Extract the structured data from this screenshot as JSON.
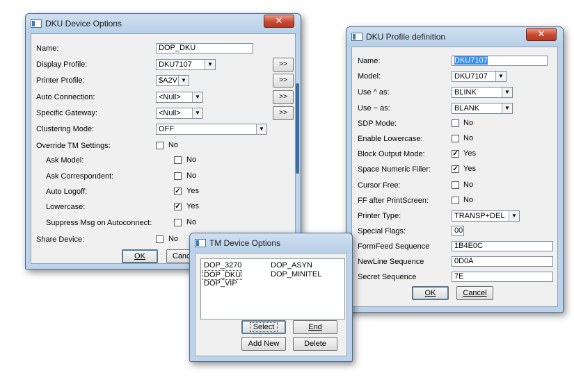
{
  "dku_window": {
    "title": "DKU Device Options",
    "name_label": "Name:",
    "name_value": "DOP_DKU",
    "display_profile_label": "Display Profile:",
    "display_profile_value": "DKU7107",
    "printer_profile_label": "Printer Profile:",
    "printer_profile_value": "$A2V",
    "auto_connection_label": "Auto Connection:",
    "auto_connection_value": "<Null>",
    "specific_gateway_label": "Specific Gateway:",
    "specific_gateway_value": "<Null>",
    "clustering_mode_label": "Clustering Mode:",
    "clustering_mode_value": "OFF",
    "override_label": "Override TM Settings:",
    "override_value": "No",
    "ask_model_label": "Ask Model:",
    "ask_model_value": "No",
    "ask_correspondent_label": "Ask Correspondent:",
    "ask_correspondent_value": "No",
    "auto_logoff_label": "Auto Logoff:",
    "auto_logoff_value": "Yes",
    "lowercase_label": "Lowercase:",
    "lowercase_value": "Yes",
    "suppress_label": "Suppress Msg on Autoconnect:",
    "suppress_value": "No",
    "share_label": "Share Device:",
    "share_value": "No",
    "more_button": ">>",
    "ok_button": "OK",
    "cancel_button": "Cancel"
  },
  "tm_window": {
    "title": "TM Device Options",
    "devices_col1": [
      "DOP_3270",
      "DOP_DKU",
      "DOP_VIP"
    ],
    "devices_col2": [
      "DOP_ASYN",
      "DOP_MINITEL"
    ],
    "select_button": "Select",
    "end_button": "End",
    "add_button": "Add New",
    "delete_button": "Delete"
  },
  "profile_window": {
    "title": "DKU Profile definition",
    "name_label": "Name:",
    "name_value": "DKU7107",
    "model_label": "Model:",
    "model_value": "DKU7107",
    "use_caret_label": "Use ^ as:",
    "use_caret_value": "BLINK",
    "use_tilde_label": "Use ~ as:",
    "use_tilde_value": "BLANK",
    "sdp_label": "SDP Mode:",
    "sdp_value": "No",
    "enable_lower_label": "Enable Lowercase:",
    "enable_lower_value": "No",
    "block_output_label": "Block Output Mode:",
    "block_output_value": "Yes",
    "space_numeric_label": "Space Numeric Filler:",
    "space_numeric_value": "Yes",
    "cursor_free_label": "Cursor Free:",
    "cursor_free_value": "No",
    "ff_after_label": "FF after PrintScreen:",
    "ff_after_value": "No",
    "printer_type_label": "Printer Type:",
    "printer_type_value": "TRANSP+DEL",
    "special_flags_label": "Special Flags:",
    "special_flags_value": "00",
    "formfeed_label": "FormFeed Sequence",
    "formfeed_value": "1B4E0C",
    "newline_label": "NewLine  Sequence",
    "newline_value": "0D0A",
    "secret_label": "Secret   Sequence",
    "secret_value": "7E",
    "ok_button": "OK",
    "cancel_button": "Cancel"
  },
  "icons": {
    "close": "close-icon",
    "dropdown": "chevron-down-icon",
    "check": "checkmark-icon",
    "window": "window-app-icon"
  },
  "colors": {
    "window_frame": "#bcd3e9",
    "close_button": "#c9492f",
    "selection": "#3a8ee8"
  }
}
